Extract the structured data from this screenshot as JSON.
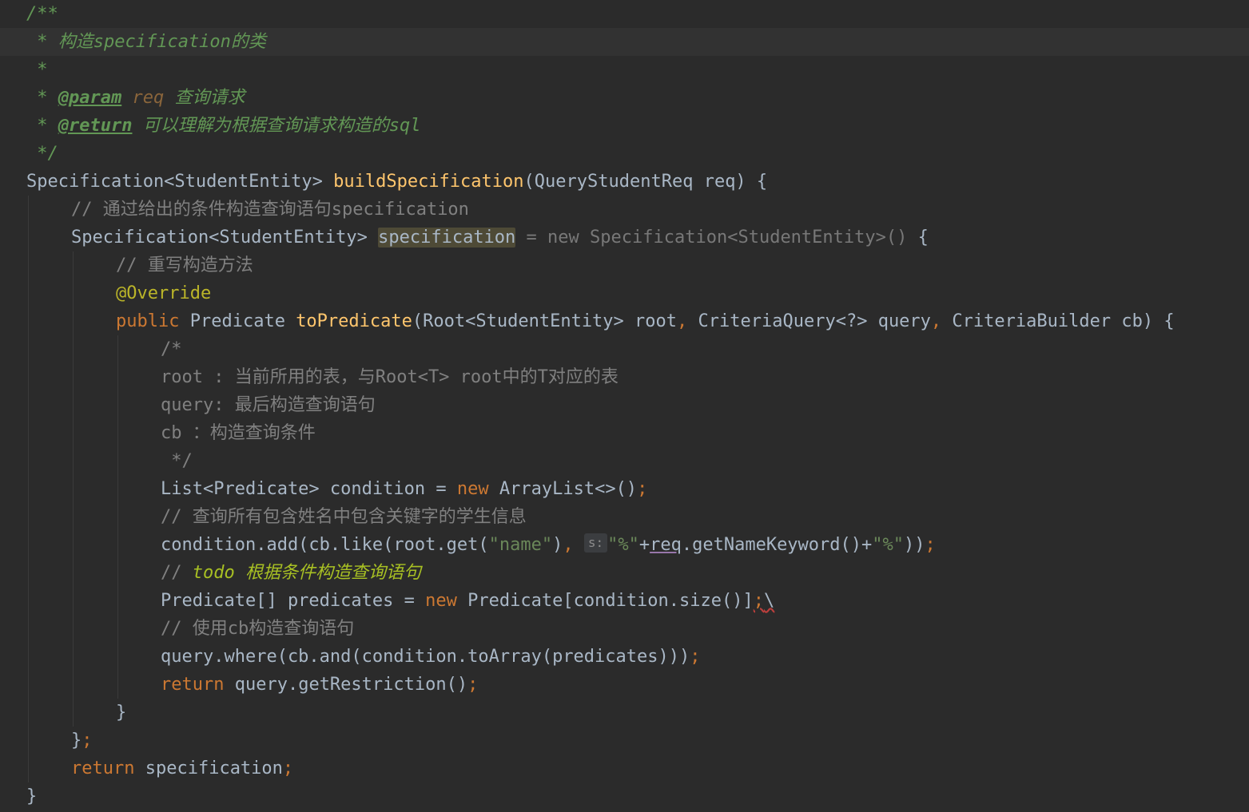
{
  "editor": {
    "lines": [
      [
        "/**"
      ],
      [
        " * 构造specification的类"
      ],
      [
        " *"
      ],
      [
        " * ",
        "@param",
        " req ",
        "查询请求"
      ],
      [
        " * ",
        "@return",
        " 可以理解为根据查询请求构造的sql"
      ],
      [
        " */"
      ],
      [
        "Specification<StudentEntity> ",
        "buildSpecification",
        "(QueryStudentReq req) {"
      ],
      [
        "// 通过给出的条件构造查询语句specification"
      ],
      [
        "Specification<StudentEntity> ",
        "specification",
        " = ",
        "new Specification<StudentEntity>()",
        " {"
      ],
      [
        "// 重写构造方法"
      ],
      [
        "@Override"
      ],
      [
        "public",
        " Predicate ",
        "toPredicate",
        "(Root<StudentEntity> root",
        ",",
        " CriteriaQuery<?> query",
        ",",
        " CriteriaBuilder cb) {"
      ],
      [
        "/*"
      ],
      [
        "root : 当前所用的表，与Root<T> root中的T对应的表"
      ],
      [
        "query: 最后构造查询语句"
      ],
      [
        "cb ：构造查询条件"
      ],
      [
        " */"
      ],
      [
        "List<Predicate> condition = ",
        "new",
        " ArrayList<>()",
        ";"
      ],
      [
        "// 查询所有包含姓名中包含关键字的学生信息"
      ],
      [
        "condition.add(cb.like(root.get(",
        "\"name\"",
        ")",
        ",",
        " ",
        "s:",
        "\"%\"",
        "+",
        "req",
        ".getNameKeyword()+",
        "\"%\"",
        "))",
        ";"
      ],
      [
        "// ",
        "todo",
        " 根据条件构造查询语句"
      ],
      [
        "Predicate[] predicates = ",
        "new",
        " Predicate[condition.size()]",
        ";",
        "\\"
      ],
      [
        "// 使用cb构造查询语句"
      ],
      [
        "query.where(cb.and(condition.toArray(predicates)))",
        ";"
      ],
      [
        "return",
        " query.getRestriction()",
        ";"
      ],
      [
        "}"
      ],
      [
        "}",
        ";"
      ],
      [
        "return",
        " specification",
        ";"
      ],
      [
        "}"
      ]
    ]
  }
}
